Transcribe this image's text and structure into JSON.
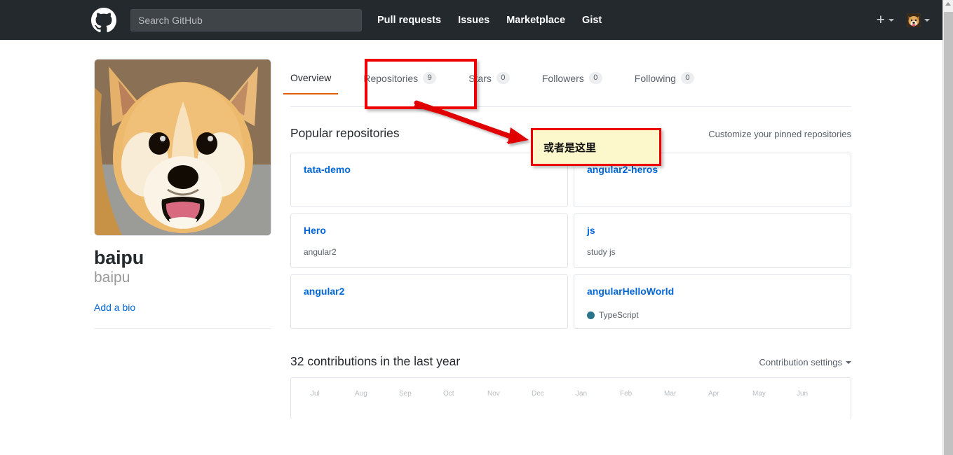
{
  "header": {
    "logo_icon": "github-mark-icon",
    "search": {
      "value": "",
      "placeholder": "Search GitHub"
    },
    "nav": [
      {
        "label": "Pull requests"
      },
      {
        "label": "Issues"
      },
      {
        "label": "Marketplace"
      },
      {
        "label": "Gist"
      }
    ],
    "create_new_icon": "plus-icon",
    "create_new_caret_icon": "chevron-down-icon",
    "user_avatar_icon": "shiba-avatar",
    "user_caret_icon": "chevron-down-icon",
    "background_color": "#24292e"
  },
  "sidebar": {
    "avatar_icon": "shiba-avatar-large",
    "name": "baipu",
    "login": "baipu",
    "add_bio_label": "Add a bio"
  },
  "tabs": [
    {
      "label": "Overview",
      "count": null,
      "active": true
    },
    {
      "label": "Repositories",
      "count": "9",
      "active": false
    },
    {
      "label": "Stars",
      "count": "0",
      "active": false
    },
    {
      "label": "Followers",
      "count": "0",
      "active": false
    },
    {
      "label": "Following",
      "count": "0",
      "active": false
    }
  ],
  "popular": {
    "title": "Popular repositories",
    "customize_label": "Customize your pinned repositories",
    "repos": [
      {
        "name": "tata-demo",
        "desc": "",
        "language": "",
        "lang_color": ""
      },
      {
        "name": "angular2-heros",
        "desc": "",
        "language": "",
        "lang_color": ""
      },
      {
        "name": "Hero",
        "desc": "angular2",
        "language": "",
        "lang_color": ""
      },
      {
        "name": "js",
        "desc": "study js",
        "language": "",
        "lang_color": ""
      },
      {
        "name": "angular2",
        "desc": "",
        "language": "",
        "lang_color": ""
      },
      {
        "name": "angularHelloWorld",
        "desc": "",
        "language": "TypeScript",
        "lang_color": "#2b7489"
      }
    ]
  },
  "contributions": {
    "title": "32 contributions in the last year",
    "settings_label": "Contribution settings",
    "settings_caret_icon": "chevron-down-icon",
    "months": [
      "Jul",
      "Aug",
      "Sep",
      "Oct",
      "Nov",
      "Dec",
      "Jan",
      "Feb",
      "Mar",
      "Apr",
      "May",
      "Jun"
    ]
  },
  "annotations": {
    "highlight_box_target": "Repositories",
    "callout_text": "或者是这里",
    "arrow_icon": "red-arrow-icon",
    "color": "#ee0000",
    "callout_background": "#fcf8cc"
  },
  "scrollbar": {
    "up_arrow_icon": "scroll-up-arrow-icon"
  },
  "tab_active_color": "#e36209"
}
